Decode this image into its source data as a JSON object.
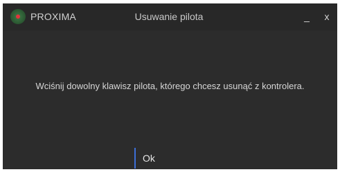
{
  "titlebar": {
    "app_name": "PROXIMA",
    "title": "Usuwanie pilota",
    "minimize_label": "_",
    "close_label": "x",
    "logo_icon": "proxima-logo-icon"
  },
  "dialog": {
    "message": "Wciśnij dowolny klawisz pilota, którego chcesz usunąć z kontrolera.",
    "ok_label": "Ok"
  },
  "colors": {
    "background": "#2c2c2c",
    "titlebar": "#282828",
    "text": "#d7d7d7",
    "accent": "#3d6fd8",
    "logo_green": "#3f7a48",
    "logo_red": "#e0353b"
  }
}
